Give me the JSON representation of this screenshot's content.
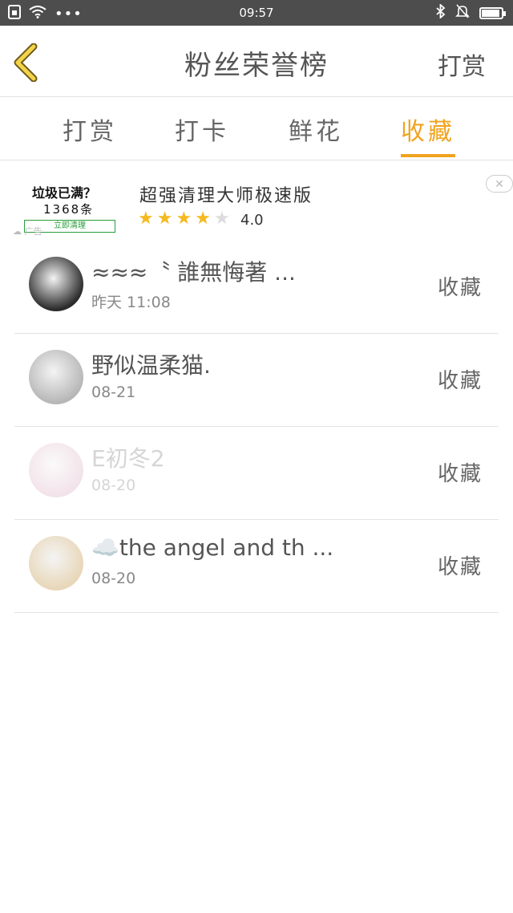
{
  "status": {
    "time": "09:57",
    "battery_level": 0.9
  },
  "header": {
    "title": "粉丝荣誉榜",
    "right_label": "打赏"
  },
  "tabs": [
    {
      "label": "打赏",
      "active": false
    },
    {
      "label": "打卡",
      "active": false
    },
    {
      "label": "鲜花",
      "active": false
    },
    {
      "label": "收藏",
      "active": true
    }
  ],
  "ad": {
    "image_line1": "垃圾已满？",
    "image_line2": "1368条",
    "image_button": "立即清理",
    "tag": "广告",
    "title": "超强清理大师极速版",
    "rating": "4.0",
    "stars_filled": 4,
    "close_symbol": "✕"
  },
  "list": [
    {
      "name": "≈≈≈〝 誰無悔著 ...",
      "date": "昨天 11:08",
      "action": "收藏",
      "avatar_color": "#2b2b2b"
    },
    {
      "name": "野似温柔猫.",
      "date": "08-21",
      "action": "收藏",
      "avatar_color": "#b7b7b7"
    },
    {
      "name": "E初冬2",
      "date": "08-20",
      "action": "收藏",
      "avatar_color": "#e3c0cf"
    },
    {
      "name": "☁️the angel and th ...",
      "date": "08-20",
      "action": "收藏",
      "avatar_color": "#e8d7b9"
    }
  ],
  "colors": {
    "accent": "#f0a320",
    "statusbar": "#4d4d4d"
  }
}
